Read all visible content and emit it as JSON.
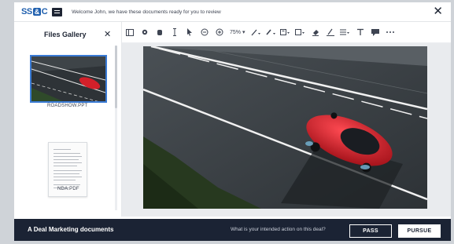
{
  "header": {
    "logo_text_1": "SS",
    "logo_text_2": "&",
    "logo_text_3": "C",
    "welcome": "Welcome John, we have these documents ready for you to review",
    "close_label": "✕"
  },
  "sidebar": {
    "title": "Files Gallery",
    "close_label": "✕",
    "files": [
      {
        "caption": "ROADSHOW.PPT",
        "selected": true
      },
      {
        "caption": "NDA.PDF",
        "selected": false
      },
      {
        "caption": "",
        "selected": false
      }
    ]
  },
  "toolbar": {
    "zoom": "75%",
    "icons": [
      "sidebar-toggle-icon",
      "settings-icon",
      "hand-pan-icon",
      "text-cursor-icon",
      "pointer-icon",
      "zoom-out-icon",
      "zoom-in-icon",
      "pen-icon",
      "highlight-icon",
      "text-box-icon",
      "shape-icon",
      "eraser-icon",
      "signature-icon",
      "list-icon",
      "text-icon",
      "comment-icon",
      "more-icon"
    ]
  },
  "footer": {
    "title": "A Deal Marketing documents",
    "question": "What is your intended action on this deal?",
    "pass_label": "PASS",
    "pursue_label": "PURSUE"
  },
  "colors": {
    "accent": "#3a7bd5",
    "footer_bg": "#1b2334",
    "car": "#d3202a"
  }
}
